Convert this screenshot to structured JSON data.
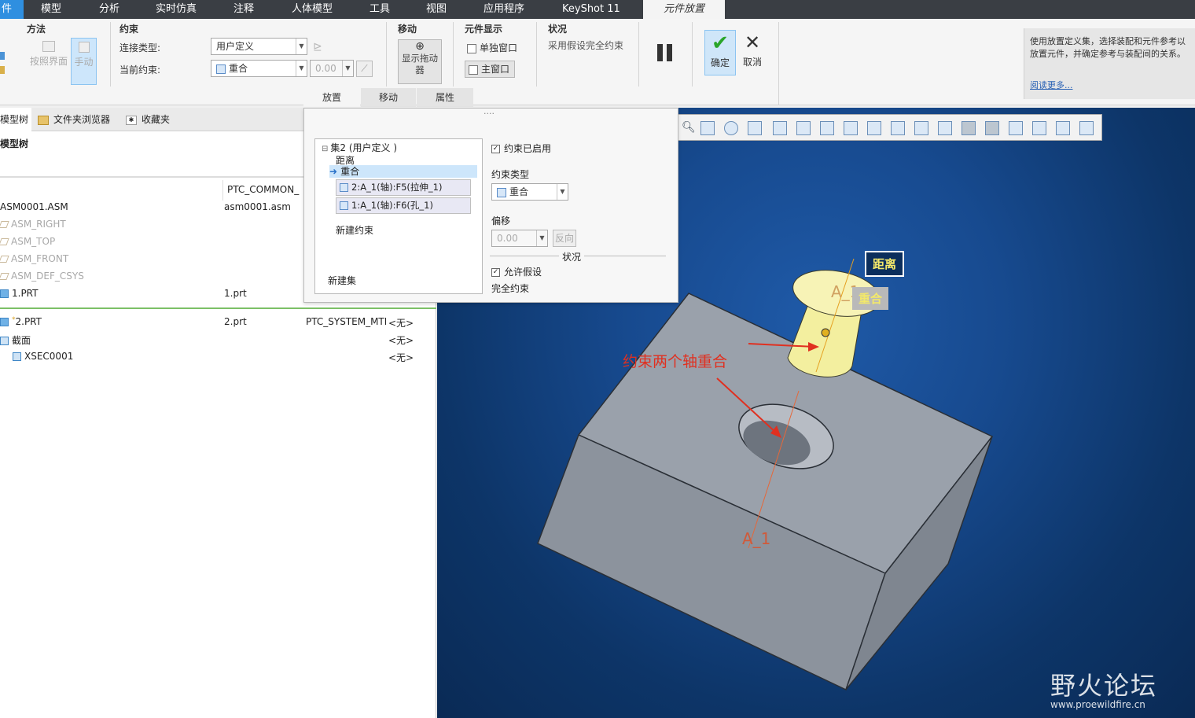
{
  "menubar": {
    "first_tab": "件",
    "tabs": [
      "模型",
      "分析",
      "实时仿真",
      "注释",
      "人体模型",
      "工具",
      "视图",
      "应用程序",
      "KeyShot 11"
    ],
    "active_tab": "元件放置"
  },
  "ribbon": {
    "method": {
      "title": "方法",
      "btn_interface": "按照界面",
      "btn_manual": "手动"
    },
    "constraint": {
      "title": "约束",
      "connection_type_label": "连接类型:",
      "connection_type_value": "用户定义",
      "current_constraint_label": "当前约束:",
      "current_constraint_value": "重合",
      "offset_value": "0.00"
    },
    "move": {
      "title": "移动",
      "btn_drag": "显示拖动器"
    },
    "display": {
      "title": "元件显示",
      "btn_separate": "单独窗口",
      "btn_main": "主窗口"
    },
    "status": {
      "title": "状况",
      "text": "采用假设完全约束"
    },
    "ok_label": "确定",
    "cancel_label": "取消",
    "colors": {
      "ok_green": "#2aa52a",
      "ok_bg": "#cfe6f9"
    }
  },
  "help": {
    "text": "使用放置定义集，选择装配和元件参考以放置元件，并确定参考与装配间的关系。",
    "link": "阅读更多..."
  },
  "subtabs": [
    "放置",
    "移动",
    "属性"
  ],
  "panel_tabs": [
    "模型树",
    "文件夹浏览器",
    "收藏夹"
  ],
  "tree": {
    "header": "模型树",
    "col_param": "PTC_COMMON_",
    "rows": [
      {
        "name": "ASM0001.ASM",
        "file": "asm0001.asm",
        "gray": false,
        "icon": "asm-icon"
      },
      {
        "name": "ASM_RIGHT",
        "file": "",
        "gray": true,
        "icon": "datum-plane-icon"
      },
      {
        "name": "ASM_TOP",
        "file": "",
        "gray": true,
        "icon": "datum-plane-icon"
      },
      {
        "name": "ASM_FRONT",
        "file": "",
        "gray": true,
        "icon": "datum-plane-icon"
      },
      {
        "name": "ASM_DEF_CSYS",
        "file": "",
        "gray": true,
        "icon": "csys-icon"
      },
      {
        "name": "1.PRT",
        "file": "1.prt",
        "gray": false,
        "icon": "part-icon"
      }
    ],
    "lower_rows": [
      {
        "name": "2.PRT",
        "file": "2.prt",
        "mtl": "PTC_SYSTEM_MTI",
        "none": "<无>",
        "icon": "part-icon"
      },
      {
        "name": "截面",
        "file": "",
        "mtl": "",
        "none": "<无>",
        "icon": "section-icon"
      },
      {
        "name": "XSEC0001",
        "file": "",
        "mtl": "",
        "none": "<无>",
        "icon": "xsec-icon"
      }
    ]
  },
  "placement": {
    "set_title": "集2 (用户定义 )",
    "distance_item": "距离",
    "coincident_item": "重合",
    "ref1": "2:A_1(轴):F5(拉伸_1)",
    "ref2": "1:A_1(轴):F6(孔_1)",
    "new_constraint": "新建约束",
    "new_set": "新建集",
    "enabled_label": "约束已启用",
    "type_label": "约束类型",
    "type_value": "重合",
    "offset_label": "偏移",
    "offset_value": "0.00",
    "reverse_label": "反向",
    "status_label": "状况",
    "allow_assume": "允许假设",
    "full_constraint": "完全约束"
  },
  "viewport": {
    "tag_distance": "距离",
    "tag_coincident": "重合",
    "annotation": "约束两个轴重合",
    "axis_label_top": "A_1",
    "axis_label_bottom": "A_1",
    "watermark_cn": "野火论坛",
    "watermark_url": "www.proewildfire.cn",
    "colors": {
      "block": "#8e959f",
      "block_top": "#9aa1ab",
      "part": "#f3ef9f",
      "annotation": "#e03020",
      "tag_border": "#ffffff"
    }
  }
}
